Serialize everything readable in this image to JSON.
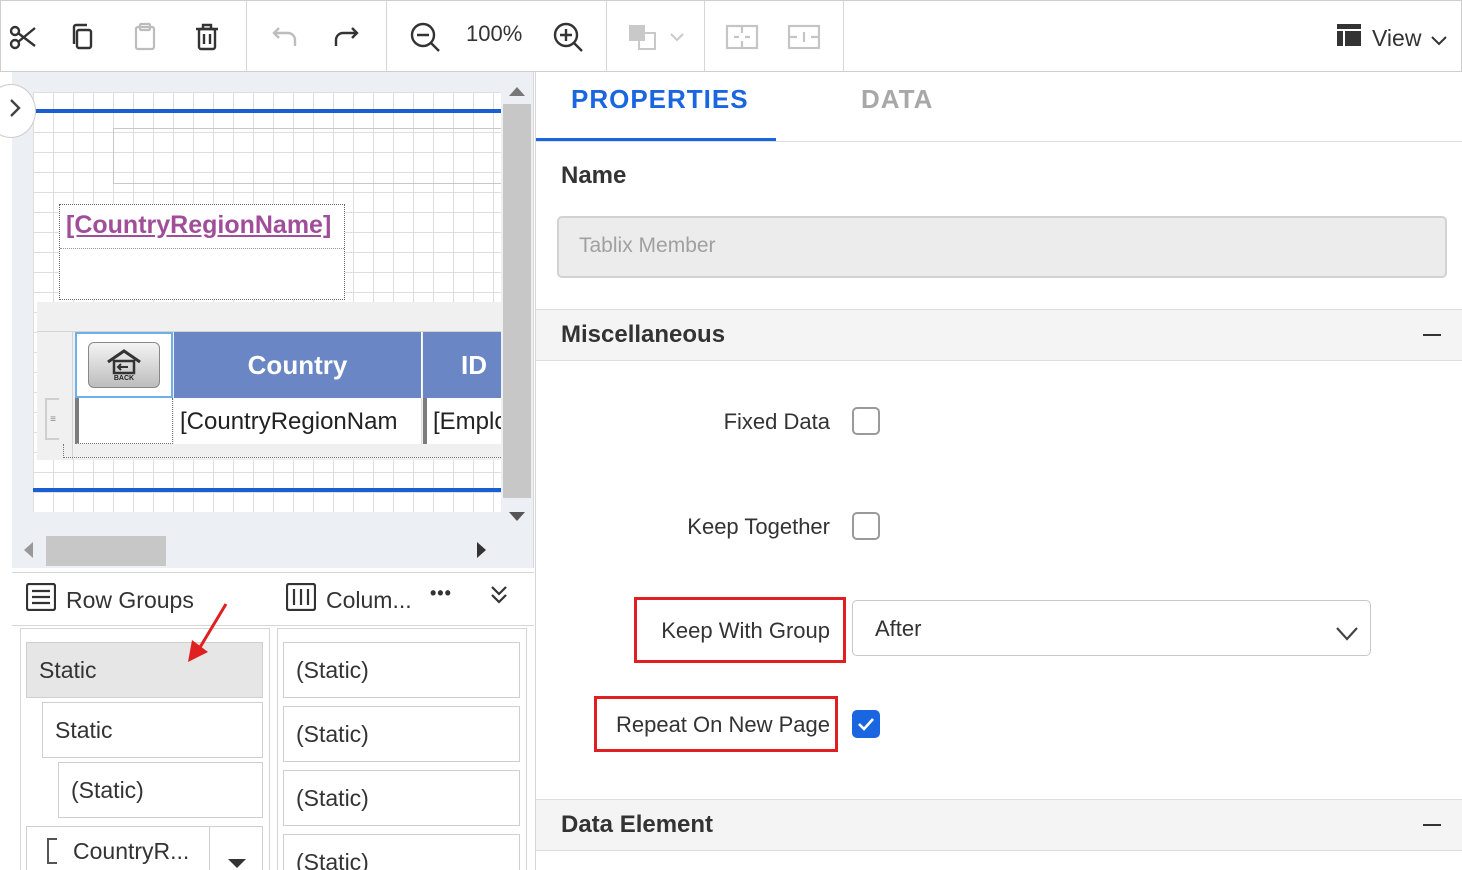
{
  "toolbar": {
    "zoom": "100%",
    "view_label": "View",
    "icons": [
      "cut-icon",
      "copy-icon",
      "paste-icon",
      "delete-icon",
      "undo-icon",
      "redo-icon",
      "zoom-out-icon",
      "zoom-in-icon",
      "shape-style-icon",
      "split-cell-icon",
      "merge-cell-icon",
      "view-layout-icon"
    ]
  },
  "design": {
    "textbox_text": "[CountryRegionName]",
    "table_headers": [
      "Country",
      "ID"
    ],
    "table_row": [
      "[CountryRegionNam",
      "[Emplo"
    ],
    "back_button_text": "BACK"
  },
  "groups": {
    "row_groups_label": "Row Groups",
    "column_groups_label": "Colum...",
    "more_label": "•••",
    "row_items": [
      "Static",
      "Static",
      "(Static)",
      "CountryR..."
    ],
    "column_items": [
      "(Static)",
      "(Static)",
      "(Static)",
      "(Static)"
    ]
  },
  "properties": {
    "tabs": [
      {
        "label": "PROPERTIES",
        "active": true
      },
      {
        "label": "DATA",
        "active": false
      }
    ],
    "name_label": "Name",
    "name_value": "Tablix Member",
    "sections": {
      "misc": "Miscellaneous",
      "data_element": "Data Element"
    },
    "fixed_data": {
      "label": "Fixed Data",
      "checked": false
    },
    "keep_together": {
      "label": "Keep Together",
      "checked": false
    },
    "keep_with_group": {
      "label": "Keep With Group",
      "value": "After"
    },
    "repeat_on_new_page": {
      "label": "Repeat On New Page",
      "checked": true
    }
  },
  "colors": {
    "accent": "#1a66e0",
    "header_fill": "#6a86c4",
    "highlight": "#e02020",
    "textbox_text": "#a04e9a"
  }
}
